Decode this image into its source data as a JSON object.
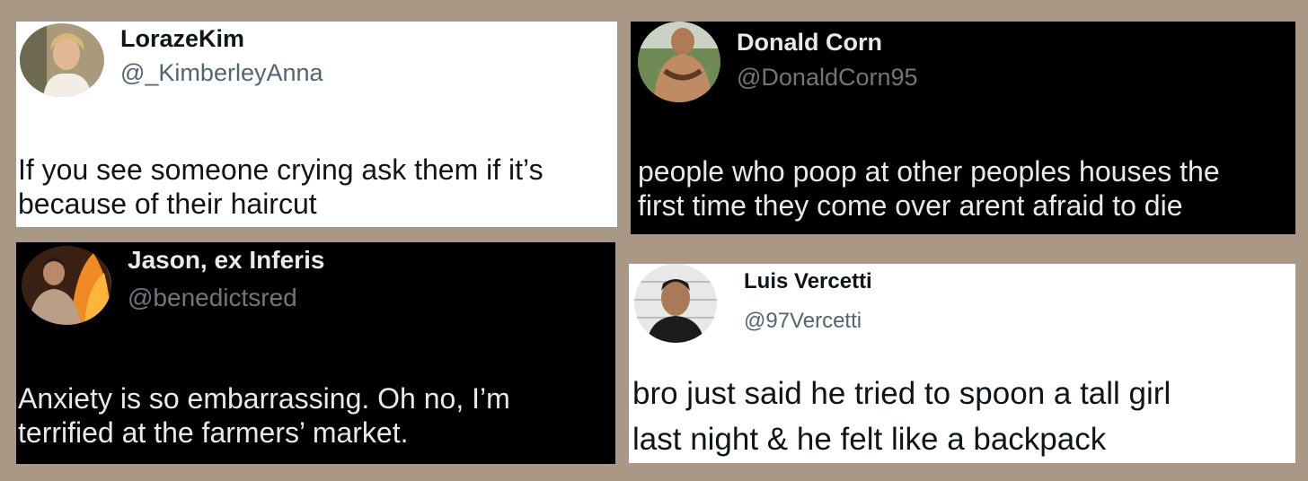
{
  "tweets": [
    {
      "display_name": "LorazeKim",
      "handle": "@_KimberleyAnna",
      "text_lines": [
        "If you see someone crying ask them if it’s",
        "because of their haircut"
      ],
      "theme": "light"
    },
    {
      "display_name": "Donald Corn",
      "handle": "@DonaldCorn95",
      "text_lines": [
        "people who poop at other peoples houses the",
        "first time they come over arent afraid to die"
      ],
      "theme": "dark"
    },
    {
      "display_name": "Jason, ex Inferis",
      "handle": "@benedictsred",
      "text_lines": [
        "Anxiety is so embarrassing. Oh no, I’m",
        "terrified at the farmers’ market."
      ],
      "theme": "dark"
    },
    {
      "display_name": "Luis Vercetti",
      "handle": "@97Vercetti",
      "text_lines": [
        "bro just said he tried to spoon a tall girl",
        "last night & he felt like a backpack"
      ],
      "theme": "light"
    }
  ],
  "colors": {
    "background": "#a99885",
    "light_card": "#ffffff",
    "dark_card": "#000000"
  }
}
